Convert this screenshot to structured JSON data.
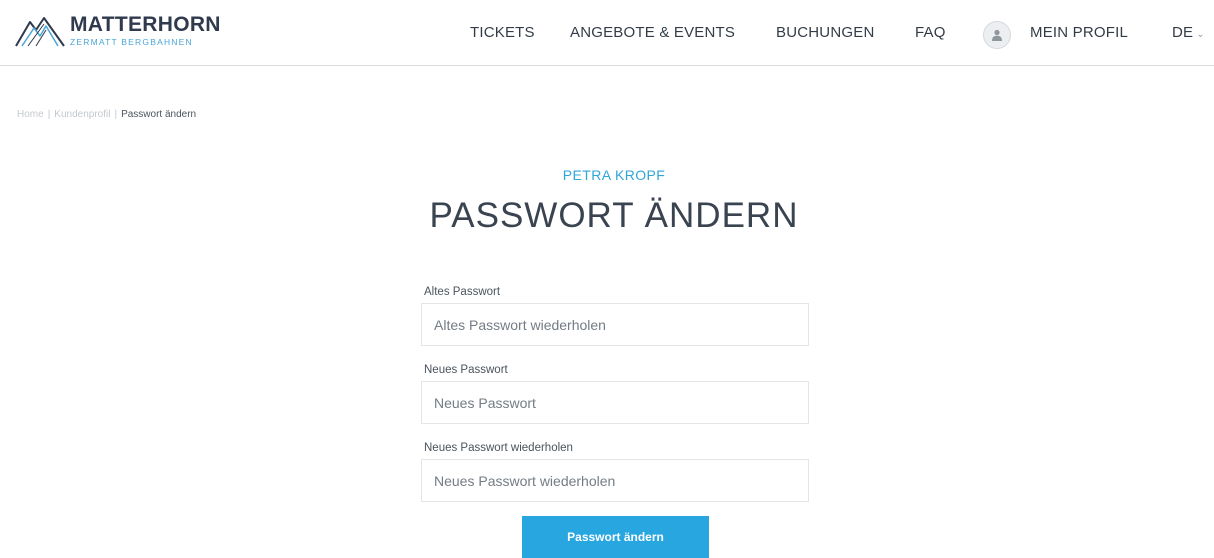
{
  "brand": {
    "name": "MATTERHORN",
    "tagline": "ZERMATT BERGBAHNEN",
    "accent_color": "#28a6e0"
  },
  "nav": {
    "tickets": "TICKETS",
    "angebote": "ANGEBOTE & EVENTS",
    "buchungen": "BUCHUNGEN",
    "faq": "FAQ",
    "profil": "MEIN PROFIL",
    "lang": "DE",
    "profile_icon": "user-icon",
    "lang_icon": "chevron-down-icon"
  },
  "breadcrumb": {
    "home": "Home",
    "kundenprofil": "Kundenprofil",
    "current": "Passwort ändern",
    "separator": "|"
  },
  "page": {
    "user_name": "PETRA KROPF",
    "title": "PASSWORT ÄNDERN"
  },
  "form": {
    "old_password": {
      "label": "Altes Passwort",
      "placeholder": "Altes Passwort wiederholen"
    },
    "new_password": {
      "label": "Neues Passwort",
      "placeholder": "Neues Passwort"
    },
    "repeat_password": {
      "label": "Neues Passwort wiederholen",
      "placeholder": "Neues Passwort wiederholen"
    },
    "submit_label": "Passwort ändern"
  }
}
